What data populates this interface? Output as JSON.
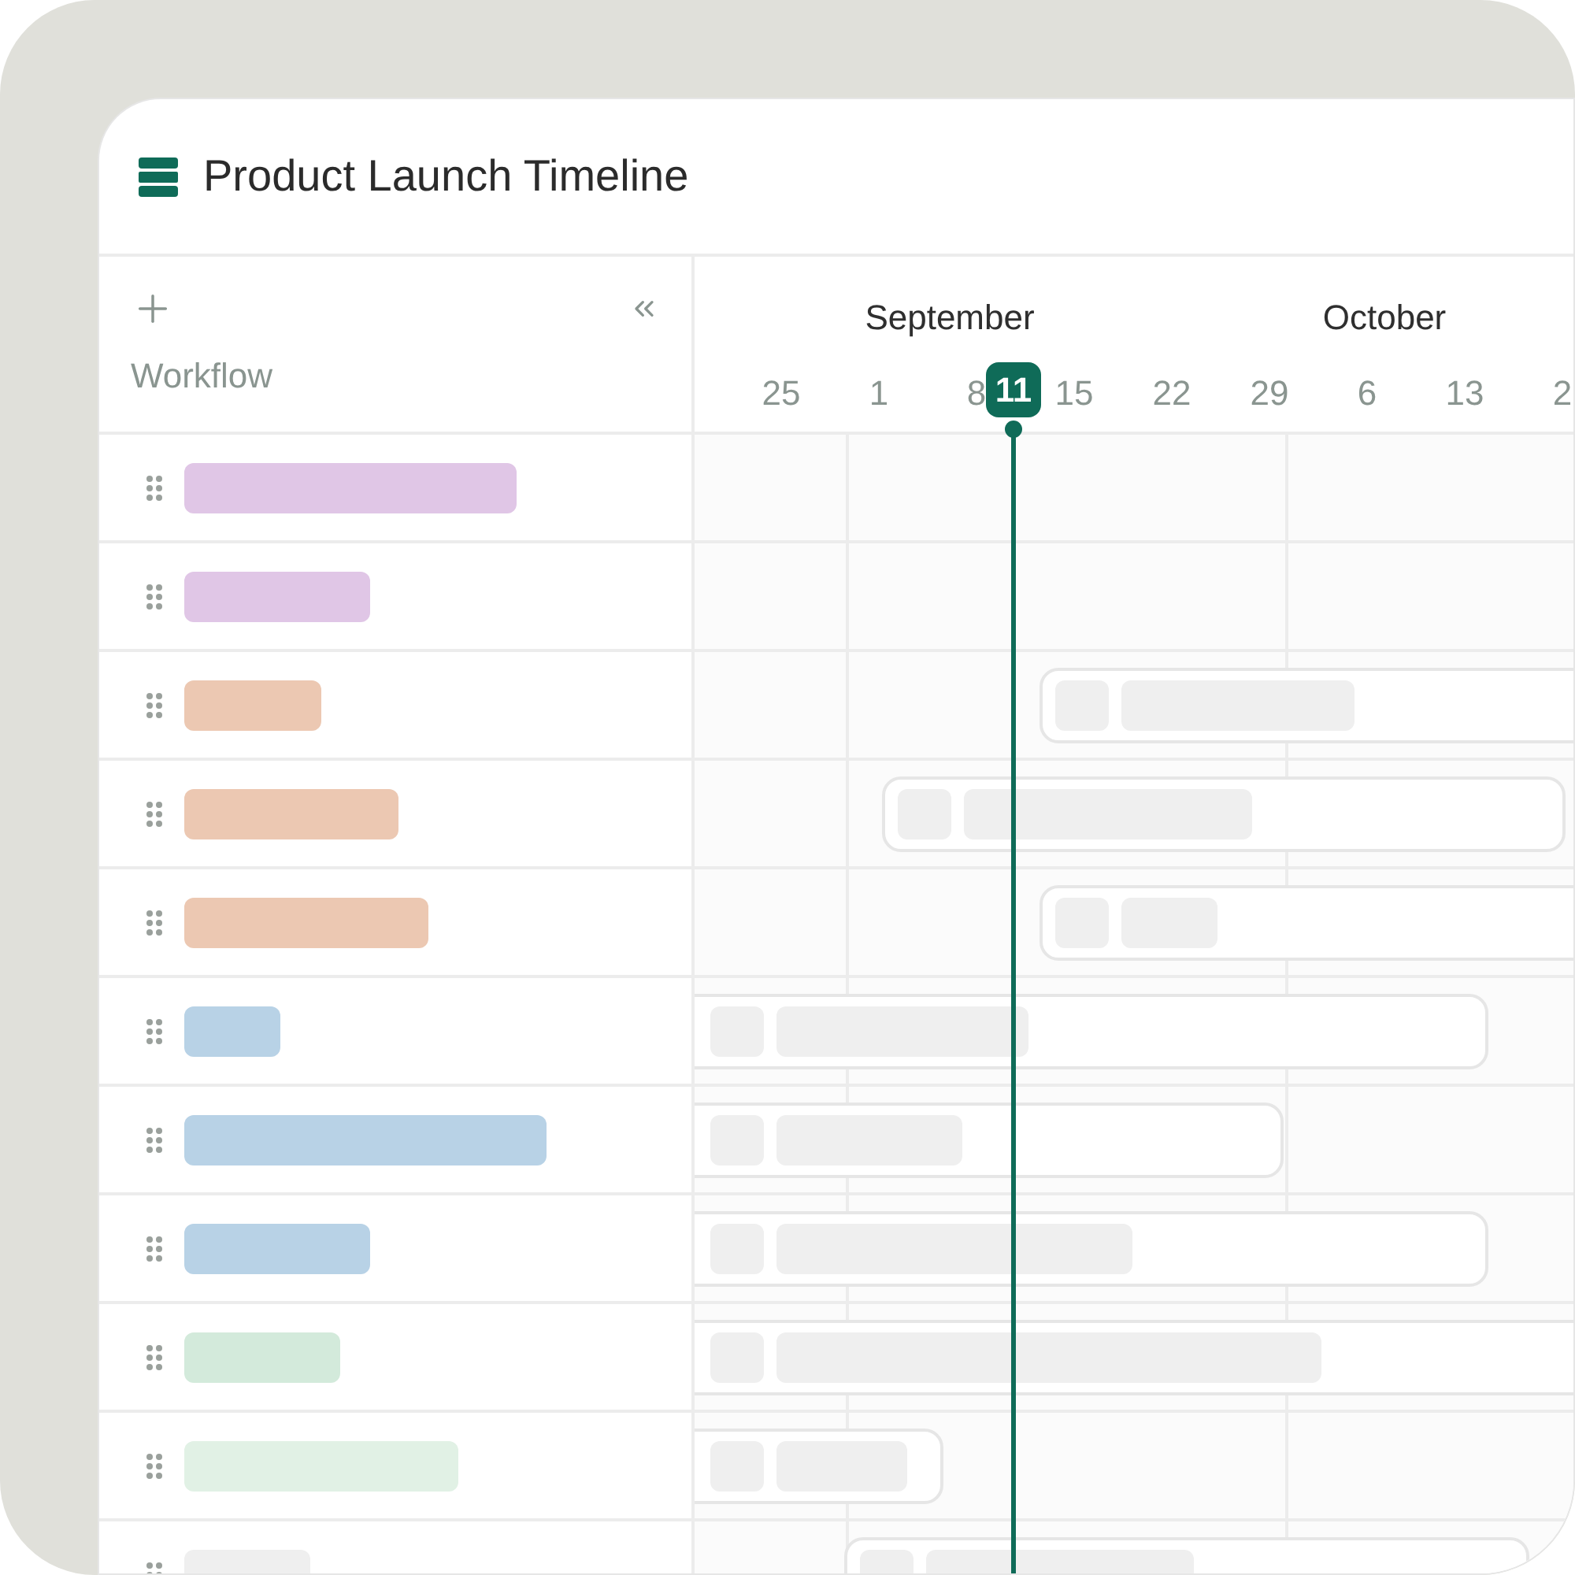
{
  "window": {
    "title": "Product Launch Timeline"
  },
  "sidebar": {
    "column_label": "Workflow"
  },
  "timeline": {
    "months": [
      "September",
      "October"
    ],
    "weeks": [
      "25",
      "1",
      "8",
      "15",
      "22",
      "29",
      "6",
      "13",
      "2"
    ],
    "today": "11"
  },
  "rows": [
    {
      "color": "#e0c6e6"
    },
    {
      "color": "#e0c6e6"
    },
    {
      "color": "#ecc8b2"
    },
    {
      "color": "#ecc8b2"
    },
    {
      "color": "#ecc8b2"
    },
    {
      "color": "#b8d2e6"
    },
    {
      "color": "#b8d2e6"
    },
    {
      "color": "#b8d2e6"
    },
    {
      "color": "#d3eadb"
    },
    {
      "color": "#e1f1e5"
    },
    {
      "color": "#efefef"
    }
  ]
}
